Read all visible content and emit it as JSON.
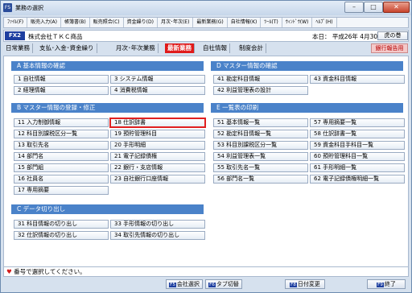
{
  "window": {
    "title": "業務の選択",
    "icon": "FS"
  },
  "menu": [
    "ﾌｧｲﾙ(F)",
    "販売入力(A)",
    "帳簿書(B)",
    "販売照合(C)",
    "資金繰り(D)",
    "月次･年次(E)",
    "最新業務(G)",
    "自社情報(K)",
    "ﾂｰﾙ(T)",
    "ｳｨﾝﾄﾞｳ(W)",
    "ﾍﾙﾌﾟ(H)"
  ],
  "company": {
    "fx_label": "FX2",
    "name": "株式会社ＴＫＣ商品",
    "date": "本日：  平成26年  4月30日(水)",
    "tora_button": "虎の巻"
  },
  "tabs": [
    "日常業務",
    "支払･入金･資金繰り",
    "月次･年次業務",
    "最新業務",
    "自社情報",
    "制度会計"
  ],
  "bank_button": "銀行報告用",
  "sections": {
    "A": {
      "title": "A  基本情報の確認",
      "buttons": [
        "1 自社情報",
        "2 経理情報",
        "3 システム情報",
        "4 消費税情報"
      ]
    },
    "D": {
      "title": "D  マスター情報の確認",
      "buttons": [
        "41 勘定科目情報",
        "42 利益管理表の設計",
        "43 資金科目情報"
      ]
    },
    "B": {
      "title": "B  マスター情報の登録・修正",
      "buttons": [
        "11 入力制御情報",
        "12 科目別課税区分一覧",
        "13 取引先名",
        "14 部門名",
        "15 部門組",
        "16 社員名",
        "17 専用摘要",
        "18 仕訳辞書",
        "19 預貯管理科目",
        "20 手形明細",
        "21 電子記録債権",
        "22 銀行・支店情報",
        "23 自社銀行口座情報"
      ]
    },
    "E": {
      "title": "E  一覧表の印刷",
      "buttons": [
        "51 基本情報一覧",
        "52 勘定科目情報一覧",
        "53 科目別課税区分一覧",
        "54 利益管理表一覧",
        "55 取引先名一覧",
        "56 部門名一覧",
        "57 専用摘要一覧",
        "58 仕訳辞書一覧",
        "59 資金科目手科目一覧",
        "60 預貯管理科目一覧",
        "61 手形明細一覧",
        "62 電子記録債権明細一覧"
      ]
    },
    "C": {
      "title": "C  データ切り出し",
      "buttons": [
        "31 科目情報の切り出し",
        "32 仕訳情報の切り出し",
        "33 手形情報の切り出し",
        "34 取引先情報の切り出し"
      ]
    }
  },
  "status": "番号で選択してください。",
  "fkeys": [
    {
      "key": "F5",
      "label": "会社選択"
    },
    {
      "key": "F6",
      "label": "タブ切替"
    },
    {
      "key": "F8",
      "label": "日付変更"
    },
    {
      "key": "F9",
      "label": "終了"
    }
  ],
  "selected_button": "18 仕訳辞書"
}
